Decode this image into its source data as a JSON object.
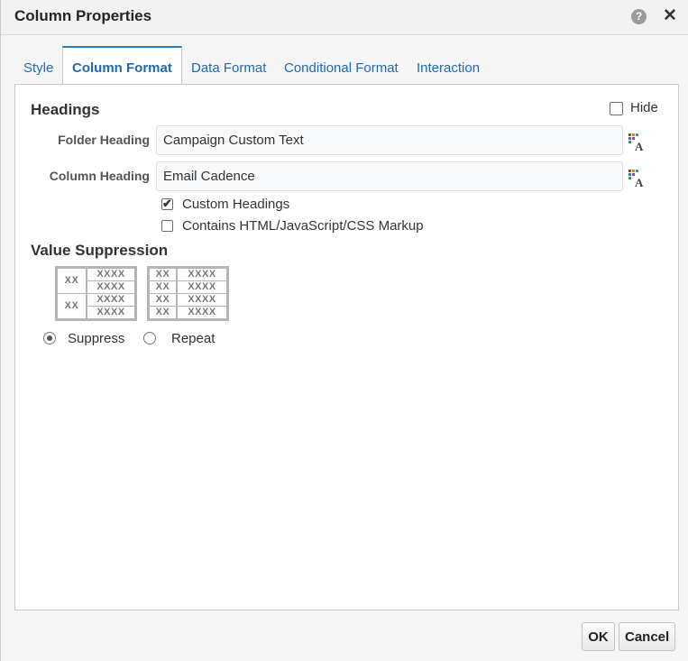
{
  "dialog": {
    "title": "Column Properties",
    "help_icon": "help-icon",
    "close_icon": "close-icon",
    "help_glyph": "?",
    "close_glyph": "✕"
  },
  "tabs": [
    {
      "label": "Style",
      "active": false
    },
    {
      "label": "Column Format",
      "active": true
    },
    {
      "label": "Data Format",
      "active": false
    },
    {
      "label": "Conditional Format",
      "active": false
    },
    {
      "label": "Interaction",
      "active": false
    }
  ],
  "headings": {
    "section_title": "Headings",
    "hide_label": "Hide",
    "hide_checked": false,
    "folder_label": "Folder Heading",
    "folder_value": "Campaign Custom Text",
    "column_label": "Column Heading",
    "column_value": "Email Cadence",
    "custom_headings_label": "Custom Headings",
    "custom_headings_checked": true,
    "html_markup_label": "Contains HTML/JavaScript/CSS Markup",
    "html_markup_checked": false
  },
  "value_suppression": {
    "section_title": "Value Suppression",
    "preview_text_short": "XX",
    "preview_text_long": "XXXX",
    "suppress_label": "Suppress",
    "repeat_label": "Repeat",
    "selected": "Suppress"
  },
  "footer": {
    "ok_label": "OK",
    "cancel_label": "Cancel"
  },
  "colors": {
    "accent": "#2a7ac0",
    "tab_text": "#1f6ab4"
  }
}
